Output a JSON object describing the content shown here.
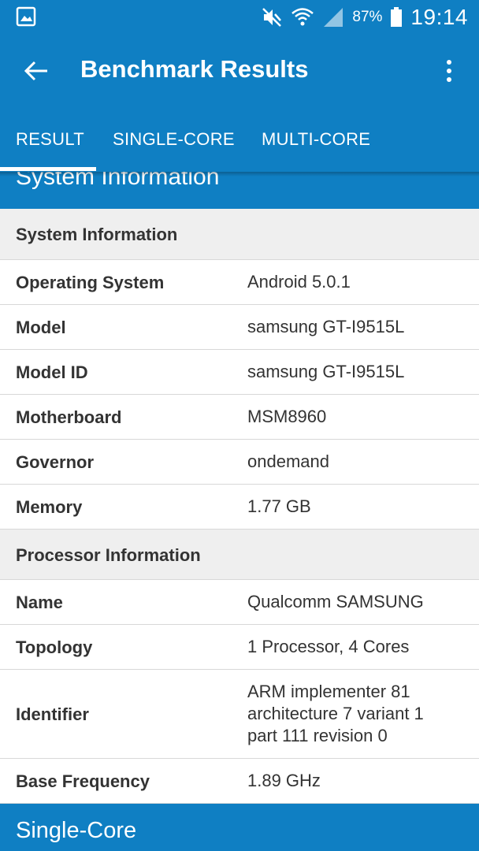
{
  "status_bar": {
    "battery_percent": "87%",
    "time": "19:14"
  },
  "app_bar": {
    "title": "Benchmark Results"
  },
  "tabs": [
    {
      "label": "RESULT",
      "selected": true
    },
    {
      "label": "SINGLE-CORE",
      "selected": false
    },
    {
      "label": "MULTI-CORE",
      "selected": false
    }
  ],
  "section_system": {
    "label": "System Information"
  },
  "table": {
    "system_group_label": "System Information",
    "system_rows": [
      {
        "key": "Operating System",
        "value": "Android 5.0.1"
      },
      {
        "key": "Model",
        "value": "samsung GT-I9515L"
      },
      {
        "key": "Model ID",
        "value": "samsung GT-I9515L"
      },
      {
        "key": "Motherboard",
        "value": "MSM8960"
      },
      {
        "key": "Governor",
        "value": "ondemand"
      },
      {
        "key": "Memory",
        "value": "1.77 GB"
      }
    ],
    "processor_group_label": "Processor Information",
    "processor_rows": [
      {
        "key": "Name",
        "value": "Qualcomm SAMSUNG"
      },
      {
        "key": "Topology",
        "value": "1 Processor, 4 Cores"
      },
      {
        "key": "Identifier",
        "value_lines": [
          "ARM implementer 81",
          "architecture 7 variant 1",
          "part 111 revision 0"
        ]
      },
      {
        "key": "Base Frequency",
        "value": "1.89 GHz"
      }
    ]
  },
  "section_single_core": {
    "label": "Single-Core"
  },
  "colors": {
    "primary": "#0f7fc3",
    "group_background": "#efefef",
    "text": "#333333"
  }
}
